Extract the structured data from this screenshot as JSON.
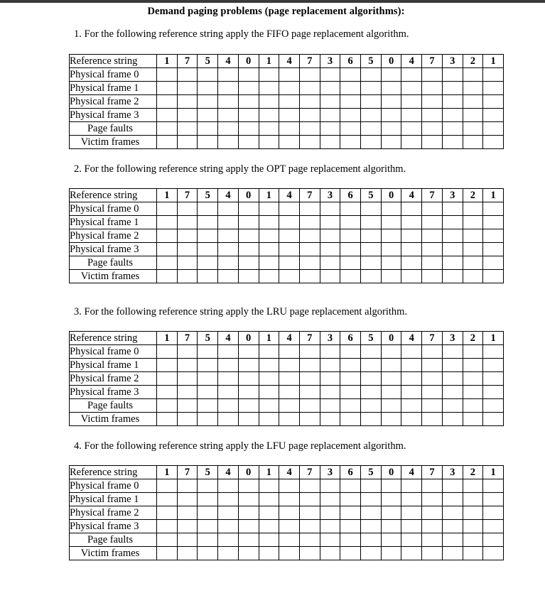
{
  "document": {
    "title": "Demand paging problems (page replacement algorithms):",
    "reference_string": [
      "1",
      "7",
      "5",
      "4",
      "0",
      "1",
      "4",
      "7",
      "3",
      "6",
      "5",
      "0",
      "4",
      "7",
      "3",
      "2",
      "1"
    ],
    "row_labels": {
      "reference_string": "Reference string",
      "frame_0": "Physical frame 0",
      "frame_1": "Physical frame 1",
      "frame_2": "Physical frame 2",
      "frame_3": "Physical frame 3",
      "page_faults": "Page faults",
      "victim_frames": "Victim frames"
    },
    "problems": [
      {
        "number": "1",
        "algorithm": "FIFO",
        "prompt": "1. For the following reference string apply the FIFO page replacement algorithm."
      },
      {
        "number": "2",
        "algorithm": "OPT",
        "prompt": "2. For the following reference string apply the OPT page replacement algorithm."
      },
      {
        "number": "3",
        "algorithm": "LRU",
        "prompt": "3. For the following reference string apply the LRU page replacement algorithm."
      },
      {
        "number": "4",
        "algorithm": "LFU",
        "prompt": "4. For the following reference string apply the LFU page replacement algorithm."
      }
    ]
  }
}
